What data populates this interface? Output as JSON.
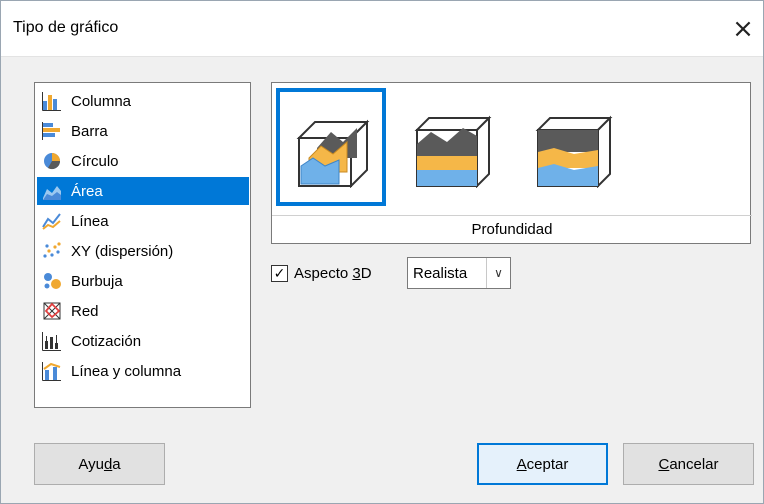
{
  "dialog": {
    "title": "Tipo de gráfico",
    "close_glyph": "×"
  },
  "chart_types": [
    {
      "label": "Columna",
      "icon": "column-chart-icon"
    },
    {
      "label": "Barra",
      "icon": "bar-chart-icon"
    },
    {
      "label": "Círculo",
      "icon": "pie-chart-icon"
    },
    {
      "label": "Área",
      "icon": "area-chart-icon",
      "selected": true
    },
    {
      "label": "Línea",
      "icon": "line-chart-icon"
    },
    {
      "label": "XY (dispersión)",
      "icon": "scatter-chart-icon"
    },
    {
      "label": "Burbuja",
      "icon": "bubble-chart-icon"
    },
    {
      "label": "Red",
      "icon": "net-chart-icon"
    },
    {
      "label": "Cotización",
      "icon": "stock-chart-icon"
    },
    {
      "label": "Línea y columna",
      "icon": "column-line-chart-icon"
    }
  ],
  "variants": {
    "caption": "Profundidad",
    "items": [
      {
        "icon": "area-3d-deep-icon",
        "selected": true
      },
      {
        "icon": "area-3d-stacked-icon",
        "selected": false
      },
      {
        "icon": "area-3d-percent-stacked-icon",
        "selected": false
      }
    ]
  },
  "aspect3d": {
    "checked": true,
    "check_glyph": "✓",
    "label_pre": "Aspecto ",
    "label_accel": "3",
    "label_post": "D",
    "scheme_value": "Realista",
    "arrow_glyph": "∨"
  },
  "buttons": {
    "help_pre": "Ayu",
    "help_accel": "d",
    "help_post": "a",
    "ok_accel": "A",
    "ok_post": "ceptar",
    "cancel_accel": "C",
    "cancel_post": "ancelar"
  },
  "colors": {
    "selection": "#0078d7",
    "area_blue": "#6fb1e9",
    "area_orange": "#f5b748",
    "area_gray": "#5a5a5a"
  }
}
